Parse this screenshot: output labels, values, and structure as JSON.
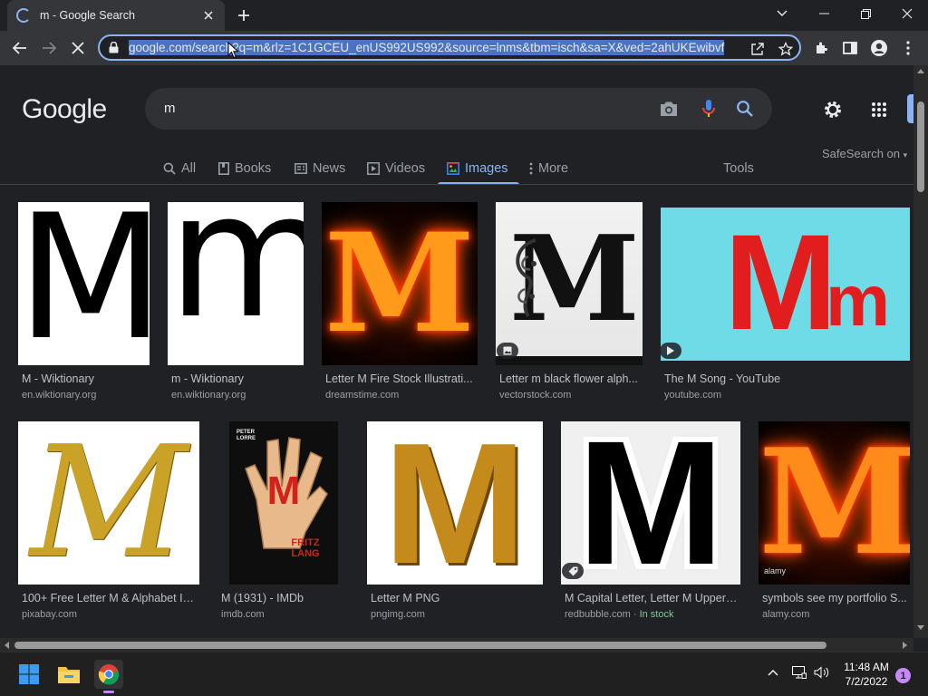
{
  "browser": {
    "tab_title": "m - Google Search",
    "url": "google.com/search?q=m&rlz=1C1GCEU_enUS992US992&source=lnms&tbm=isch&sa=X&ved=2ahUKEwibvf"
  },
  "google": {
    "logo_text": "Google",
    "query": "m",
    "safesearch": "SafeSearch on",
    "tools_label": "Tools",
    "nav_tabs": [
      {
        "label": "All",
        "icon": "search-icon"
      },
      {
        "label": "Books",
        "icon": "book-icon"
      },
      {
        "label": "News",
        "icon": "news-icon"
      },
      {
        "label": "Videos",
        "icon": "video-icon"
      },
      {
        "label": "Images",
        "icon": "image-icon",
        "active": true
      },
      {
        "label": "More",
        "icon": "dots-vertical-icon"
      }
    ]
  },
  "results": [
    {
      "title": "M - Wiktionary",
      "source": "en.wiktionary.org"
    },
    {
      "title": "m - Wiktionary",
      "source": "en.wiktionary.org"
    },
    {
      "title": "Letter M Fire Stock Illustrati...",
      "source": "dreamstime.com"
    },
    {
      "title": "Letter m black flower alph...",
      "source": "vectorstock.com",
      "badge": "image-icon"
    },
    {
      "title": "The M Song - YouTube",
      "source": "youtube.com",
      "badge": "play-icon"
    },
    {
      "title": "100+ Free Letter M & Alphabet Ill...",
      "source": "pixabay.com"
    },
    {
      "title": "M (1931) - IMDb",
      "source": "imdb.com"
    },
    {
      "title": "Letter M PNG",
      "source": "pngimg.com"
    },
    {
      "title": "M Capital Letter, Letter M Upperc...",
      "source": "redbubble.com",
      "stock": "In stock",
      "badge": "tag-icon"
    },
    {
      "title": "symbols see my portfolio S...",
      "source": "alamy.com"
    }
  ],
  "thumb_text": {
    "wiktionary_upper": "M",
    "wiktionary_lower": "m",
    "fire": "M",
    "flower": "M",
    "song_upper": "M",
    "song_lower": "m",
    "script": "M",
    "poster_top": "PETER LORRE",
    "poster_letter": "M",
    "poster_name": "FRITZ LANG",
    "gold": "M",
    "sticker": "M",
    "alamy_fire": "M",
    "watermark": "alamy"
  },
  "taskbar": {
    "time": "11:48 AM",
    "date": "7/2/2022",
    "notification_count": "1"
  },
  "colors": {
    "accent": "#8ab4f8",
    "page_bg": "#202124",
    "song_bg": "#6fdbe6",
    "song_letter": "#e11d1d"
  }
}
